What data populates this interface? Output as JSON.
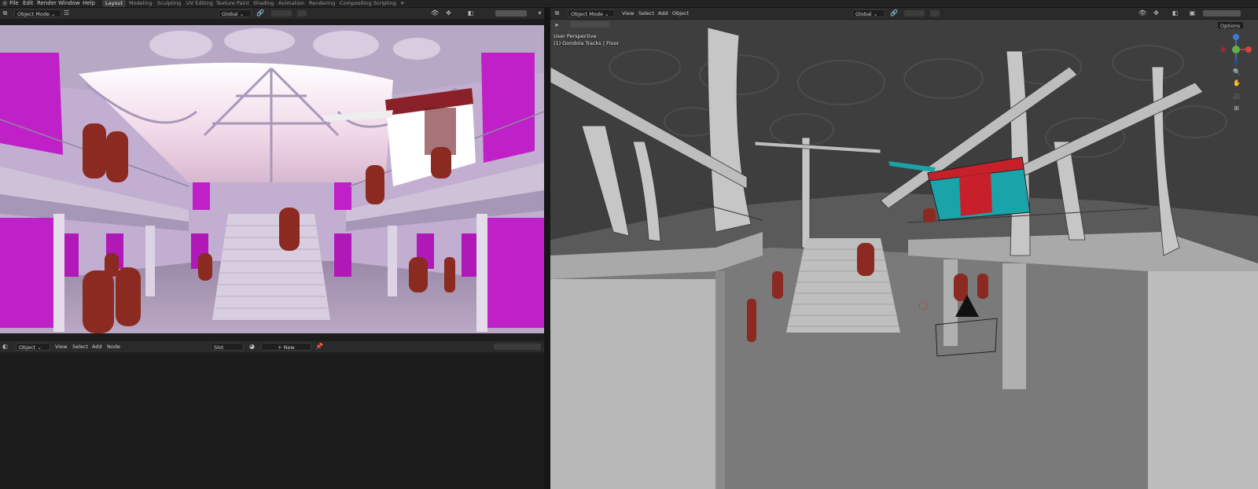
{
  "top_menu": {
    "items": [
      "File",
      "Edit",
      "Render",
      "Window",
      "Help"
    ],
    "workspaces": [
      "Layout",
      "Modeling",
      "Sculpting",
      "UV Editing",
      "Texture Paint",
      "Shading",
      "Animation",
      "Rendering",
      "Compositing",
      "Scripting"
    ],
    "active_workspace": "Layout",
    "add_tab": "+"
  },
  "left_header": {
    "mode": "Object Mode",
    "orientation": "Global"
  },
  "node_header": {
    "type": "Object",
    "menus": [
      "View",
      "Select",
      "Add",
      "Node"
    ],
    "slot": "Slot",
    "new_label": "New"
  },
  "viewport_header": {
    "mode": "Object Mode",
    "menus": [
      "View",
      "Select",
      "Add",
      "Object"
    ],
    "orientation": "Global"
  },
  "viewport_overlay": {
    "perspective": "User Perspective",
    "collection": "(1) Gondola Tracks | Floor",
    "options": "Options"
  },
  "colors": {
    "magenta": "#c020c8",
    "gondola_red": "#c8202a",
    "gondola_teal": "#1aa3a8",
    "figure_red": "#8a2a20"
  },
  "icons": [
    "blender-logo-icon",
    "hamburger-menu-icon",
    "pin-icon",
    "gizmo-axes-icon",
    "zoom-icon",
    "hand-pan-icon",
    "camera-icon",
    "grid-icon",
    "play-icon"
  ]
}
